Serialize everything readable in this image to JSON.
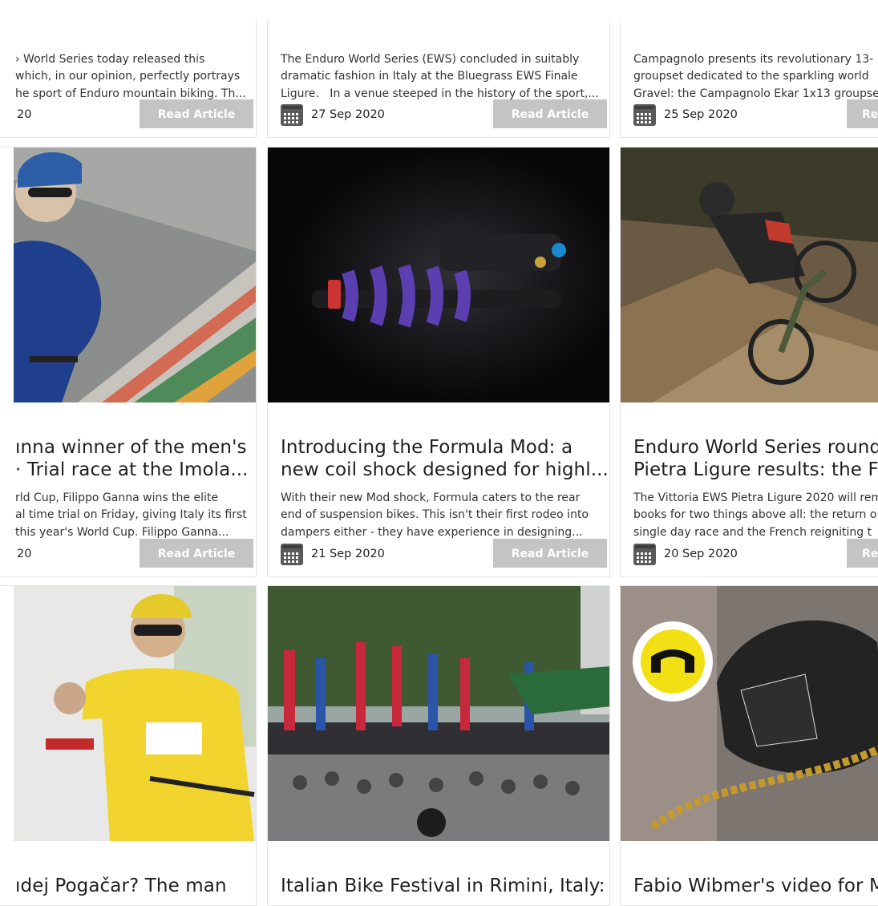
{
  "top_row": [
    {
      "excerpt": [
        "› World Series today released this",
        "which, in our opinion, perfectly portrays",
        "he sport of Enduro mountain biking. Th..."
      ],
      "date": "20",
      "button": "Read Article"
    },
    {
      "excerpt": [
        "The Enduro World Series (EWS) concluded in suitably",
        "dramatic fashion in Italy at the Bluegrass EWS Finale",
        "Ligure.   In a venue steeped in the history of the sport,..."
      ],
      "date": "27 Sep 2020",
      "button": "Read Article"
    },
    {
      "excerpt": [
        "Campagnolo presents its revolutionary 13-",
        "groupset dedicated to the sparkling world",
        "Gravel: the Campagnolo Ekar 1x13 groupset"
      ],
      "date": "25 Sep 2020",
      "button": "Re"
    }
  ],
  "middle_row": [
    {
      "image": "cyclist-time-trial-photo",
      "title": [
        "ınna winner of the men's",
        "· Trial race at the Imola..."
      ],
      "excerpt": [
        "rld Cup, Filippo Ganna wins the elite",
        "al time trial on Friday, giving Italy its first",
        "this year's World Cup. Filippo Ganna..."
      ],
      "date": "20",
      "button": "Read Article"
    },
    {
      "image": "coil-shock-photo",
      "title": [
        "Introducing the Formula Mod: a",
        "new coil shock designed for highl..."
      ],
      "excerpt": [
        "With their new Mod shock, Formula caters to the rear",
        "end of suspension bikes. This isn't their first rodeo into",
        "dampers either - they have experience in designing..."
      ],
      "date": "21 Sep 2020",
      "button": "Read Article"
    },
    {
      "image": "enduro-rider-photo",
      "title": [
        "Enduro World Series round",
        "Pietra Ligure results: the Fre"
      ],
      "excerpt": [
        "The Vittoria EWS Pietra Ligure 2020 will rem",
        "books for two things above all: the return o",
        "single day race and the French reigniting t"
      ],
      "date": "20 Sep 2020",
      "button": "Re"
    }
  ],
  "bottom_row": [
    {
      "image": "yellow-jersey-rider-photo",
      "title": [
        "ıdej Pogačar? The man"
      ]
    },
    {
      "image": "bike-festival-crowd-photo",
      "title": [
        "Italian Bike Festival in Rimini, Italy:"
      ]
    },
    {
      "image": "brake-caliper-photo",
      "title": [
        "Fabio Wibmer's video for M"
      ]
    }
  ],
  "colors": {
    "button_bg": "#c4c4c4",
    "button_text": "#ffffff",
    "border": "#e6e6e6",
    "calendar_icon": "#5a5a5a"
  }
}
